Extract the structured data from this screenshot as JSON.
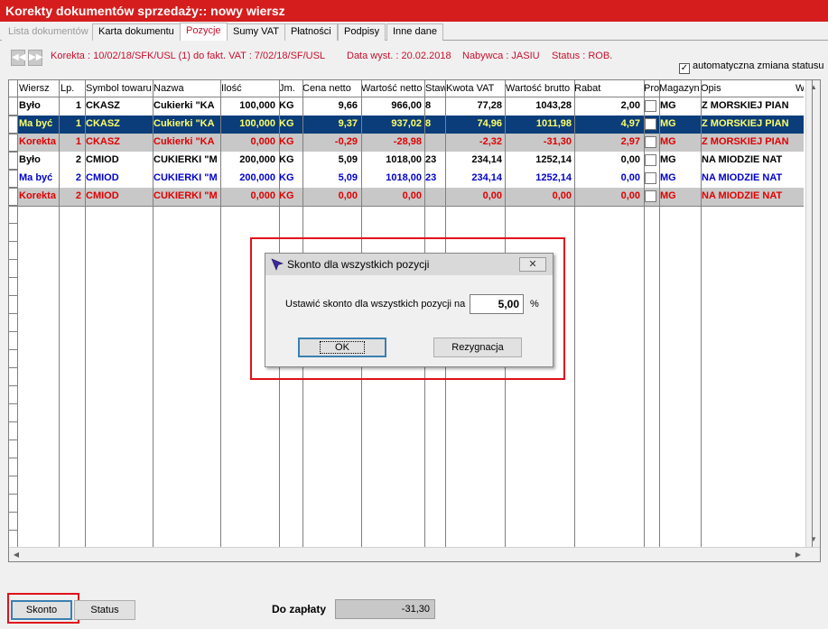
{
  "window": {
    "title": "Korekty dokumentów sprzedaży:: nowy wiersz"
  },
  "tabs": [
    {
      "label": "Lista dokumentów",
      "state": "disabled"
    },
    {
      "label": "Karta dokumentu",
      "state": "normal"
    },
    {
      "label": "Pozycje",
      "state": "active"
    },
    {
      "label": "Sumy VAT",
      "state": "normal"
    },
    {
      "label": "Płatności",
      "state": "normal"
    },
    {
      "label": "Podpisy",
      "state": "normal"
    },
    {
      "label": "Inne dane",
      "state": "normal"
    }
  ],
  "info": {
    "korekta": "Korekta : 10/02/18/SFK/USL (1) do fakt. VAT : 7/02/18/SF/USL",
    "data_wyst": "Data wyst. : 20.02.2018",
    "nabywca": "Nabywca : JASIU",
    "status": "Status : ROB."
  },
  "auto_status": {
    "label": "automatyczna zmiana statusu",
    "checked": true
  },
  "grid": {
    "columns": [
      "Wiersz",
      "Lp.",
      "Symbol towaru",
      "Nazwa",
      "Ilość",
      "Jm.",
      "Cena netto",
      "Wartość netto",
      "Staw",
      "Kwota VAT",
      "Wartość brutto",
      "Rabat",
      "Pro",
      "Magazyn",
      "Opis",
      "W"
    ],
    "rows": [
      {
        "style": "bylo",
        "cells": [
          "Było",
          "1",
          "CKASZ",
          "Cukierki \"KA",
          "100,000",
          "KG",
          "9,66",
          "966,00",
          "8",
          "77,28",
          "1043,28",
          "2,00",
          "",
          "MG",
          "Z MORSKIEJ PIAN"
        ]
      },
      {
        "style": "selected",
        "cells": [
          "Ma być",
          "1",
          "CKASZ",
          "Cukierki \"KA",
          "100,000",
          "KG",
          "9,37",
          "937,02",
          "8",
          "74,96",
          "1011,98",
          "4,97",
          "",
          "MG",
          "Z MORSKIEJ PIAN"
        ]
      },
      {
        "style": "korekta",
        "cells": [
          "Korekta",
          "1",
          "CKASZ",
          "Cukierki \"KA",
          "0,000",
          "KG",
          "-0,29",
          "-28,98",
          "",
          "-2,32",
          "-31,30",
          "2,97",
          "",
          "MG",
          "Z MORSKIEJ PIAN"
        ]
      },
      {
        "style": "bylo",
        "cells": [
          "Było",
          "2",
          "CMIOD",
          "CUKIERKI \"M",
          "200,000",
          "KG",
          "5,09",
          "1018,00",
          "23",
          "234,14",
          "1252,14",
          "0,00",
          "",
          "MG",
          "NA MIODZIE NAT"
        ]
      },
      {
        "style": "mabyc",
        "cells": [
          "Ma być",
          "2",
          "CMIOD",
          "CUKIERKI \"M",
          "200,000",
          "KG",
          "5,09",
          "1018,00",
          "23",
          "234,14",
          "1252,14",
          "0,00",
          "",
          "MG",
          "NA MIODZIE NAT"
        ]
      },
      {
        "style": "korekta",
        "cells": [
          "Korekta",
          "2",
          "CMIOD",
          "CUKIERKI \"M",
          "0,000",
          "KG",
          "0,00",
          "0,00",
          "",
          "0,00",
          "0,00",
          "0,00",
          "",
          "MG",
          "NA MIODZIE NAT"
        ]
      }
    ]
  },
  "dialog": {
    "title": "Skonto dla wszystkich pozycji",
    "label": "Ustawić skonto dla wszystkich pozycji na",
    "value": "5,00",
    "unit": "%",
    "ok": "OK",
    "cancel": "Rezygnacja",
    "close": "✕"
  },
  "footer": {
    "skonto": "Skonto",
    "status": "Status",
    "do_zaplaty_label": "Do zapłaty",
    "do_zaplaty_value": "-31,30"
  },
  "colors": {
    "title_bar": "#d51d1d",
    "selected_row_bg": "#0a3d7a",
    "selected_row_fg": "#ffff66",
    "korekta_row_bg": "#c8c8c8",
    "korekta_fg": "#e00000",
    "mabyc_fg": "#0000cc",
    "highlight_outline": "#e0111a"
  }
}
